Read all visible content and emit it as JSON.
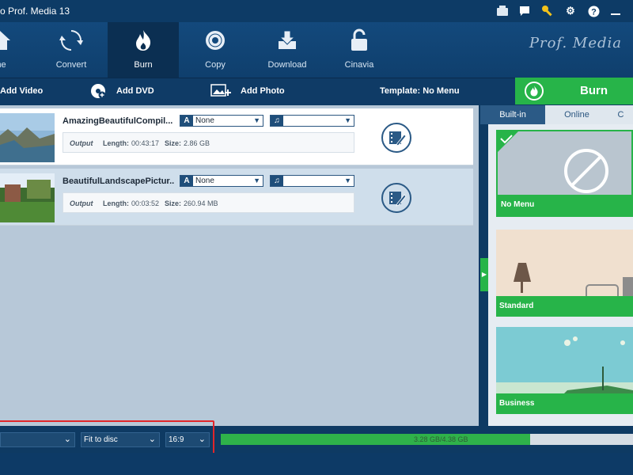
{
  "window": {
    "title": "o Prof. Media 13"
  },
  "nav": {
    "items": [
      {
        "label": "me"
      },
      {
        "label": "Convert"
      },
      {
        "label": "Burn"
      },
      {
        "label": "Copy"
      },
      {
        "label": "Download"
      },
      {
        "label": "Cinavia"
      }
    ],
    "brand": "Prof. Media"
  },
  "actions": {
    "add_video": "Add Video",
    "add_dvd": "Add DVD",
    "add_photo": "Add Photo",
    "template": "Template: No Menu",
    "burn": "Burn"
  },
  "files": [
    {
      "title": "AmazingBeautifulCompil...",
      "subtitle": "None",
      "audio": "",
      "output_label": "Output",
      "length_label": "Length:",
      "length": "00:43:17",
      "size_label": "Size:",
      "size": "2.86 GB"
    },
    {
      "title": "BeautifulLandscapePictur...",
      "subtitle": "None",
      "audio": "",
      "output_label": "Output",
      "length_label": "Length:",
      "length": "00:03:52",
      "size_label": "Size:",
      "size": "260.94 MB"
    }
  ],
  "templates": {
    "tabs": [
      {
        "label": "Built-in"
      },
      {
        "label": "Online"
      },
      {
        "label": "C"
      }
    ],
    "items": [
      {
        "label": "No Menu"
      },
      {
        "label": "Standard"
      },
      {
        "label": "Business"
      }
    ]
  },
  "status": {
    "quality": "",
    "fit": "Fit to disc",
    "aspect": "16:9",
    "usage_text": "3.28 GB/4.38 GB",
    "usage_fraction": 0.75
  },
  "colors": {
    "accent": "#27b449",
    "nav_bg": "#0f3f6d",
    "highlight": "#e0262a"
  }
}
